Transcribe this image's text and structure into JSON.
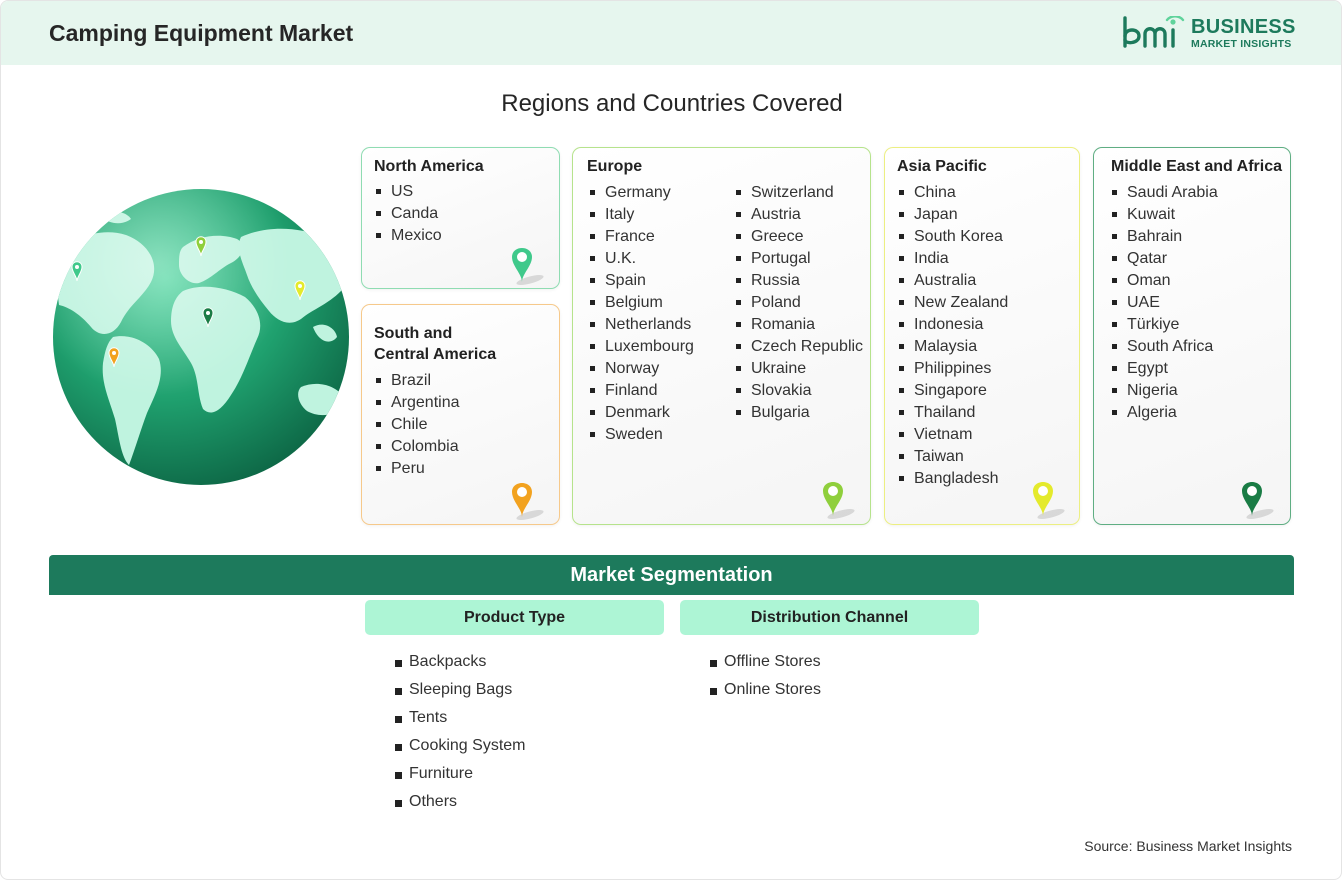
{
  "header": {
    "title": "Camping Equipment Market",
    "logo_main": "BUSINESS",
    "logo_sub": "MARKET INSIGHTS",
    "logo_mark": "bmi"
  },
  "regions_title": "Regions and Countries Covered",
  "regions": {
    "north_america": {
      "title": "North America",
      "countries": [
        "US",
        "Canda",
        "Mexico"
      ],
      "pin_color": "#3fc98b"
    },
    "south_america": {
      "title_line1": "South and",
      "title_line2": "Central America",
      "countries": [
        "Brazil",
        "Argentina",
        "Chile",
        "Colombia",
        "Peru"
      ],
      "pin_color": "#f2a21f"
    },
    "europe": {
      "title": "Europe",
      "countries_col1": [
        "Germany",
        "Italy",
        "France",
        "U.K.",
        "Spain",
        "Belgium",
        "Netherlands",
        "Luxembourg",
        "Norway",
        "Finland",
        "Denmark",
        "Sweden"
      ],
      "countries_col2": [
        "Switzerland",
        "Austria",
        "Greece",
        "Portugal",
        "Russia",
        "Poland",
        "Romania",
        "Czech Republic",
        "Ukraine",
        "Slovakia",
        "Bulgaria"
      ],
      "pin_color": "#8fcf3c"
    },
    "asia_pacific": {
      "title": "Asia Pacific",
      "countries": [
        "China",
        "Japan",
        "South Korea",
        "India",
        "Australia",
        "New Zealand",
        "Indonesia",
        "Malaysia",
        "Philippines",
        "Singapore",
        "Thailand",
        "Vietnam",
        "Taiwan",
        "Bangladesh"
      ],
      "pin_color": "#e4ea2c"
    },
    "middle_east_africa": {
      "title": "Middle East and Africa",
      "countries": [
        "Saudi Arabia",
        "Kuwait",
        "Bahrain",
        "Qatar",
        "Oman",
        "UAE",
        "Türkiye",
        "South Africa",
        "Egypt",
        "Nigeria",
        "Algeria"
      ],
      "pin_color": "#1a7c45"
    }
  },
  "segmentation": {
    "title": "Market Segmentation",
    "product_type": {
      "heading": "Product Type",
      "items": [
        "Backpacks",
        "Sleeping Bags",
        "Tents",
        "Cooking System",
        "Furniture",
        "Others"
      ]
    },
    "distribution_channel": {
      "heading": "Distribution Channel",
      "items": [
        "Offline Stores",
        "Online Stores"
      ]
    }
  },
  "source": "Source: Business Market Insights",
  "colors": {
    "brand_green": "#1d7a5c",
    "header_bg": "#e6f6ee",
    "segment_head_bg": "#adf5d5",
    "border_north_america": "#8fdcb2",
    "border_south_america": "#f6c98b",
    "border_europe": "#b6e38c",
    "border_asia_pacific": "#ecef82",
    "border_middle_east_africa": "#5fae83"
  }
}
